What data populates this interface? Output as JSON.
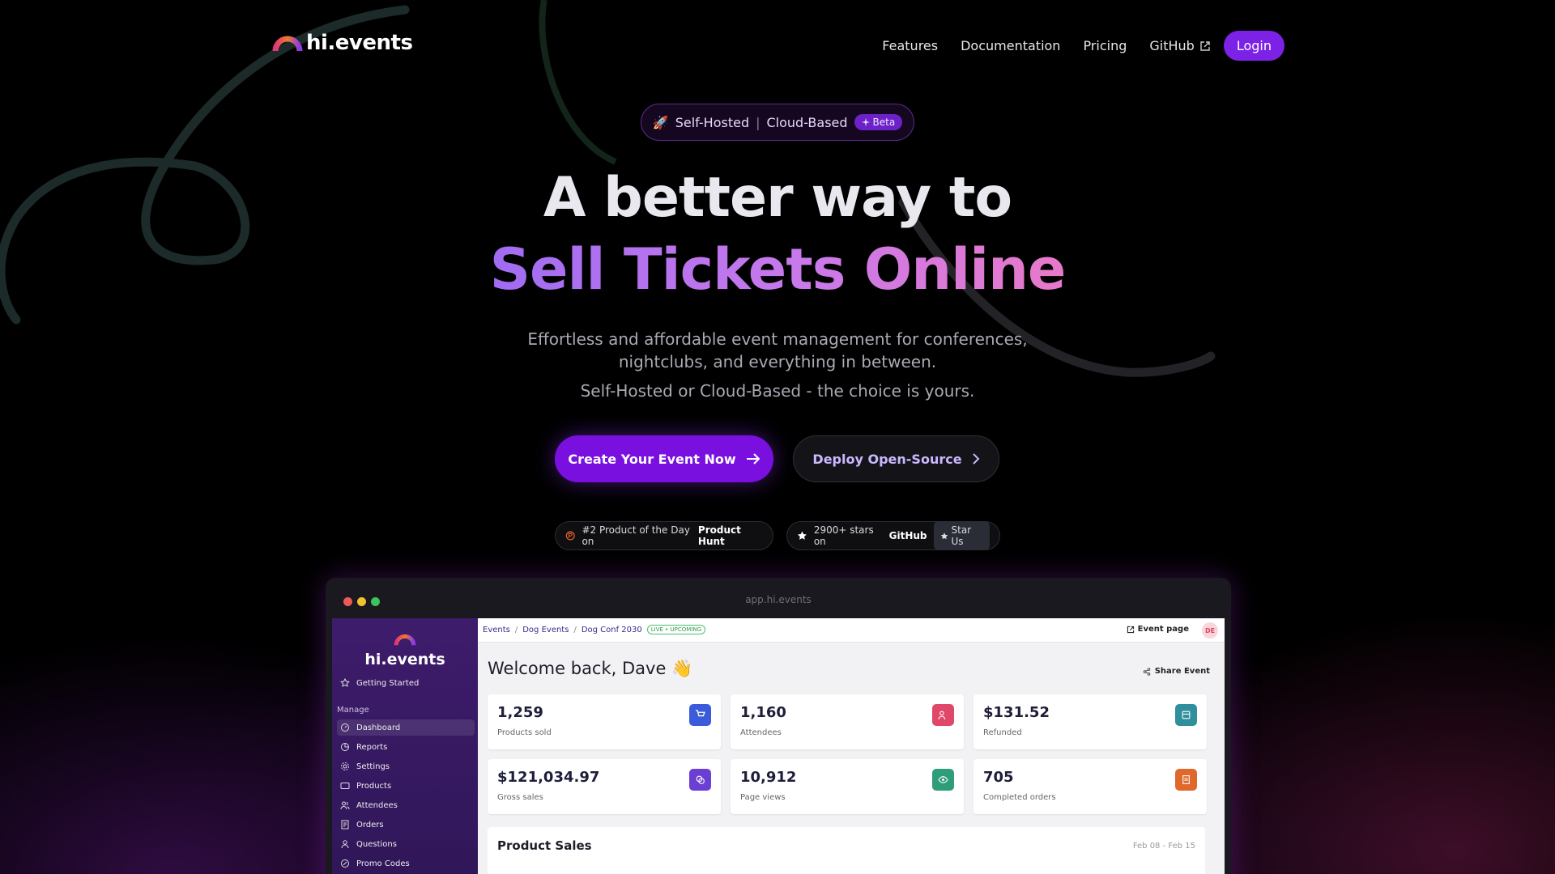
{
  "brand": {
    "logo_text": "hi.events"
  },
  "nav": {
    "links": [
      "Features",
      "Documentation",
      "Pricing",
      "GitHub"
    ],
    "login": "Login"
  },
  "hero": {
    "pill": {
      "rocket": "🚀",
      "left": "Self-Hosted",
      "separator": "|",
      "right": "Cloud-Based",
      "badge": "Beta"
    },
    "title_line1": "A better way to",
    "title_line2": "Sell Tickets Online",
    "subtitle_line1": "Effortless and affordable event management for conferences,",
    "subtitle_line2": "nightclubs, and everything in between.",
    "tagline": "Self-Hosted or Cloud-Based - the choice is yours.",
    "cta_primary": "Create Your Event Now",
    "cta_secondary": "Deploy Open-Source",
    "product_hunt": {
      "prefix": "#2 Product of the Day on",
      "bold": "Product Hunt"
    },
    "github_stars": {
      "prefix": "2900+ stars on",
      "bold": "GitHub",
      "button": "Star Us"
    }
  },
  "app_window": {
    "url": "app.hi.events",
    "sidebar": {
      "logo_text": "hi.events",
      "getting_started": "Getting Started",
      "section": "Manage",
      "items": [
        "Dashboard",
        "Reports",
        "Settings",
        "Products",
        "Attendees",
        "Orders",
        "Questions",
        "Promo Codes"
      ]
    },
    "breadcrumb": [
      "Events",
      "Dog Events",
      "Dog Conf 2030"
    ],
    "status_badge": "LIVE • UPCOMING",
    "event_page": "Event page",
    "avatar": "DE",
    "welcome": "Welcome back, Dave 👋",
    "share": "Share Event",
    "stats": [
      {
        "value": "1,259",
        "label": "Products sold",
        "color": "#3b5bdb"
      },
      {
        "value": "1,160",
        "label": "Attendees",
        "color": "#e0486a"
      },
      {
        "value": "$131.52",
        "label": "Refunded",
        "color": "#2f8f9d"
      },
      {
        "value": "$121,034.97",
        "label": "Gross sales",
        "color": "#6b3fd4"
      },
      {
        "value": "10,912",
        "label": "Page views",
        "color": "#2f9d7a"
      },
      {
        "value": "705",
        "label": "Completed orders",
        "color": "#e0682a"
      }
    ],
    "product_sales": {
      "title": "Product Sales",
      "range": "Feb 08 - Feb 15"
    }
  },
  "colors": {
    "accent": "#7c22e6",
    "background": "#000000"
  }
}
